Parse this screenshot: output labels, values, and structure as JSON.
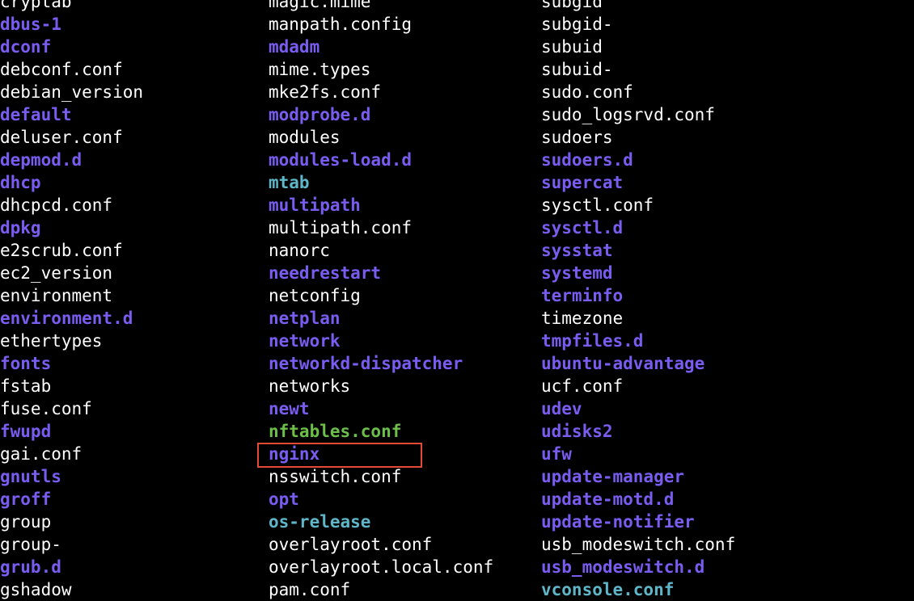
{
  "colors": {
    "background": "#000000",
    "file": "#ffffff",
    "directory": "#7a5cf0",
    "symlink": "#5fb6c8",
    "executable": "#6cc04a",
    "highlight_border": "#e34a33"
  },
  "columns": [
    {
      "entries": [
        {
          "name": "cryptab",
          "type": "file"
        },
        {
          "name": "dbus-1",
          "type": "dir"
        },
        {
          "name": "dconf",
          "type": "dir"
        },
        {
          "name": "debconf.conf",
          "type": "file"
        },
        {
          "name": "debian_version",
          "type": "file"
        },
        {
          "name": "default",
          "type": "dir"
        },
        {
          "name": "deluser.conf",
          "type": "file"
        },
        {
          "name": "depmod.d",
          "type": "dir"
        },
        {
          "name": "dhcp",
          "type": "dir"
        },
        {
          "name": "dhcpcd.conf",
          "type": "file"
        },
        {
          "name": "dpkg",
          "type": "dir"
        },
        {
          "name": "e2scrub.conf",
          "type": "file"
        },
        {
          "name": "ec2_version",
          "type": "file"
        },
        {
          "name": "environment",
          "type": "file"
        },
        {
          "name": "environment.d",
          "type": "dir"
        },
        {
          "name": "ethertypes",
          "type": "file"
        },
        {
          "name": "fonts",
          "type": "dir"
        },
        {
          "name": "fstab",
          "type": "file"
        },
        {
          "name": "fuse.conf",
          "type": "file"
        },
        {
          "name": "fwupd",
          "type": "dir"
        },
        {
          "name": "gai.conf",
          "type": "file"
        },
        {
          "name": "gnutls",
          "type": "dir"
        },
        {
          "name": "groff",
          "type": "dir"
        },
        {
          "name": "group",
          "type": "file"
        },
        {
          "name": "group-",
          "type": "file"
        },
        {
          "name": "grub.d",
          "type": "dir"
        },
        {
          "name": "gshadow",
          "type": "file"
        }
      ]
    },
    {
      "entries": [
        {
          "name": "magic.mime",
          "type": "file"
        },
        {
          "name": "manpath.config",
          "type": "file"
        },
        {
          "name": "mdadm",
          "type": "dir"
        },
        {
          "name": "mime.types",
          "type": "file"
        },
        {
          "name": "mke2fs.conf",
          "type": "file"
        },
        {
          "name": "modprobe.d",
          "type": "dir"
        },
        {
          "name": "modules",
          "type": "file"
        },
        {
          "name": "modules-load.d",
          "type": "dir"
        },
        {
          "name": "mtab",
          "type": "link"
        },
        {
          "name": "multipath",
          "type": "dir"
        },
        {
          "name": "multipath.conf",
          "type": "file"
        },
        {
          "name": "nanorc",
          "type": "file"
        },
        {
          "name": "needrestart",
          "type": "dir"
        },
        {
          "name": "netconfig",
          "type": "file"
        },
        {
          "name": "netplan",
          "type": "dir"
        },
        {
          "name": "network",
          "type": "dir"
        },
        {
          "name": "networkd-dispatcher",
          "type": "dir"
        },
        {
          "name": "networks",
          "type": "file"
        },
        {
          "name": "newt",
          "type": "dir"
        },
        {
          "name": "nftables.conf",
          "type": "exec"
        },
        {
          "name": "nginx",
          "type": "dir",
          "highlighted": true
        },
        {
          "name": "nsswitch.conf",
          "type": "file"
        },
        {
          "name": "opt",
          "type": "dir"
        },
        {
          "name": "os-release",
          "type": "link"
        },
        {
          "name": "overlayroot.conf",
          "type": "file"
        },
        {
          "name": "overlayroot.local.conf",
          "type": "file"
        },
        {
          "name": "pam.conf",
          "type": "file"
        }
      ]
    },
    {
      "entries": [
        {
          "name": "subgid",
          "type": "file"
        },
        {
          "name": "subgid-",
          "type": "file"
        },
        {
          "name": "subuid",
          "type": "file"
        },
        {
          "name": "subuid-",
          "type": "file"
        },
        {
          "name": "sudo.conf",
          "type": "file"
        },
        {
          "name": "sudo_logsrvd.conf",
          "type": "file"
        },
        {
          "name": "sudoers",
          "type": "file"
        },
        {
          "name": "sudoers.d",
          "type": "dir"
        },
        {
          "name": "supercat",
          "type": "dir"
        },
        {
          "name": "sysctl.conf",
          "type": "file"
        },
        {
          "name": "sysctl.d",
          "type": "dir"
        },
        {
          "name": "sysstat",
          "type": "dir"
        },
        {
          "name": "systemd",
          "type": "dir"
        },
        {
          "name": "terminfo",
          "type": "dir"
        },
        {
          "name": "timezone",
          "type": "file"
        },
        {
          "name": "tmpfiles.d",
          "type": "dir"
        },
        {
          "name": "ubuntu-advantage",
          "type": "dir"
        },
        {
          "name": "ucf.conf",
          "type": "file"
        },
        {
          "name": "udev",
          "type": "dir"
        },
        {
          "name": "udisks2",
          "type": "dir"
        },
        {
          "name": "ufw",
          "type": "dir"
        },
        {
          "name": "update-manager",
          "type": "dir"
        },
        {
          "name": "update-motd.d",
          "type": "dir"
        },
        {
          "name": "update-notifier",
          "type": "dir"
        },
        {
          "name": "usb_modeswitch.conf",
          "type": "file"
        },
        {
          "name": "usb_modeswitch.d",
          "type": "dir"
        },
        {
          "name": "vconsole.conf",
          "type": "link"
        }
      ]
    }
  ]
}
